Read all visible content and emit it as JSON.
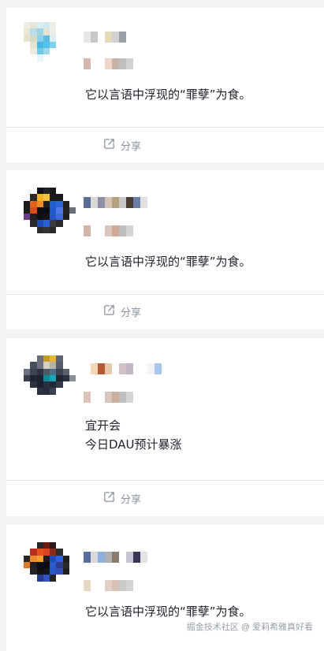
{
  "feed": {
    "posts": [
      {
        "author_name": "",
        "text": "它以言语中浮现的“罪孽”为食。",
        "share_label": "分享",
        "avatar_colors": [
          "#eeeee6",
          "#e6e6d8",
          "#d8eef4",
          "#cde9ef",
          "#ecece5",
          "#ffffff",
          "#ffffff",
          "#ffffff",
          "#e9e6d5",
          "#b8dde6",
          "#9fd3e3",
          "#e6e3d2",
          "#eeeee7",
          "#ffffff",
          "#ffffff",
          "#ffffff",
          "#e8e2ca",
          "#d7d8c6",
          "#8dd0e9",
          "#5bbde3",
          "#dbeef4",
          "#ffffff",
          "#ffffff",
          "#ffffff",
          "#ffffff",
          "#e6e3d0",
          "#48b7e6",
          "#53c3ea",
          "#7fd2ee",
          "#ffffff",
          "#ffffff",
          "#ffffff",
          "#ffffff",
          "#eeeae0",
          "#6fc9ea",
          "#9ed8ee",
          "#ffffff",
          "#ffffff",
          "#ffffff",
          "#ffffff",
          "#ffffff",
          "#ffffff",
          "#eaf6fb",
          "#ffffff",
          "#ffffff",
          "#ffffff",
          "#ffffff",
          "#ffffff",
          "#ffffff",
          "#ffffff",
          "#ffffff",
          "#ffffff",
          "#ffffff",
          "#ffffff",
          "#ffffff",
          "#ffffff",
          "#ffffff",
          "#ffffff",
          "#ffffff",
          "#ffffff",
          "#ffffff",
          "#ffffff",
          "#ffffff",
          "#ffffff"
        ],
        "name_colors": [
          "#e7e7e7",
          "#c5c9cc",
          "#ffffff",
          "#e4dbb8",
          "#d2d2d2",
          "#9aa1a6"
        ],
        "meta_colors": [
          "#d4b7ad",
          "#ffffff",
          "#ffffff",
          "#f0d6c8",
          "#c7b4a9",
          "#bfbfbf",
          "#d2d2d2"
        ]
      },
      {
        "author_name": "",
        "text": "它以言语中浮现的“罪孽”为食。",
        "share_label": "分享",
        "avatar_colors": [
          "#ffffff",
          "#ffffff",
          "#111111",
          "#222222",
          "#1b1b1b",
          "#ffffff",
          "#ffffff",
          "#ffffff",
          "#ffffff",
          "#2a2a2a",
          "#f2b329",
          "#f6c23a",
          "#1c1c1c",
          "#1a1a1a",
          "#ffffff",
          "#ffffff",
          "#1a1a1a",
          "#e4621f",
          "#f08d26",
          "#1d1d1d",
          "#1d5fcf",
          "#2a66d6",
          "#212121",
          "#ffffff",
          "#1c1c1c",
          "#e04a1a",
          "#0f0f0f",
          "#0c0c0c",
          "#2157cf",
          "#4e79e6",
          "#232323",
          "#6a6f7a",
          "#6b3c8c",
          "#1e1e1e",
          "#111111",
          "#141414",
          "#2456c9",
          "#3f6ad8",
          "#1f1f1f",
          "#ffffff",
          "#ffffff",
          "#2a2a2a",
          "#1f4bb8",
          "#2b5ed4",
          "#3a3a3a",
          "#2a2a2a",
          "#ffffff",
          "#ffffff",
          "#ffffff",
          "#ffffff",
          "#2d2d2d",
          "#343434",
          "#2b2b2b",
          "#ffffff",
          "#ffffff",
          "#ffffff",
          "#ffffff",
          "#ffffff",
          "#ffffff",
          "#ffffff",
          "#ffffff",
          "#ffffff",
          "#ffffff",
          "#ffffff"
        ],
        "name_colors": [
          "#5c6d96",
          "#d8d8d8",
          "#8f8fa8",
          "#d3c6b8",
          "#b5a27d",
          "#c6c6c6",
          "#4a3c33",
          "#6a7fa8",
          "#e1e1e1"
        ],
        "meta_colors": [
          "#d2b4aa",
          "#ffffff",
          "#ffffff",
          "#d6c6bd",
          "#cfa996",
          "#bdbdbd",
          "#d4d4d4"
        ]
      },
      {
        "author_name": "",
        "text": "宜开会\n今日DAU预计暴涨",
        "share_label": "分享",
        "avatar_colors": [
          "#ffffff",
          "#ffffff",
          "#6b6e78",
          "#c49a2b",
          "#e8b533",
          "#5d6470",
          "#ffffff",
          "#ffffff",
          "#ffffff",
          "#4a4f5e",
          "#6c7280",
          "#d6d0c2",
          "#b9b3a6",
          "#545b69",
          "#ffffff",
          "#ffffff",
          "#6d717b",
          "#3d4350",
          "#2d3340",
          "#515866",
          "#4b6e86",
          "#3a4352",
          "#5a606c",
          "#ffffff",
          "#3a3f4c",
          "#202734",
          "#1c2230",
          "#0f8a9a",
          "#16a6b4",
          "#1f2736",
          "#2a313f",
          "#8b8f96",
          "#ffffff",
          "#2c3340",
          "#1b2130",
          "#273040",
          "#212837",
          "#333b48",
          "#ffffff",
          "#ffffff",
          "#ffffff",
          "#ffffff",
          "#2b3242",
          "#262d3c",
          "#3a4150",
          "#ffffff",
          "#ffffff",
          "#ffffff",
          "#ffffff",
          "#ffffff",
          "#ffffff",
          "#ffffff",
          "#ffffff",
          "#ffffff",
          "#ffffff",
          "#ffffff",
          "#ffffff",
          "#ffffff",
          "#ffffff",
          "#ffffff",
          "#ffffff",
          "#ffffff",
          "#ffffff",
          "#ffffff"
        ],
        "name_colors": [
          "#ffffff",
          "#f4d5b8",
          "#b15a35",
          "#e8c6a8",
          "#ffffff",
          "#d3c0c4",
          "#c2b8c4",
          "#ffffff",
          "#ffffff",
          "#f2f4f7",
          "#a9c6ec"
        ],
        "meta_colors": [
          "#dbc3b8",
          "#ffffff",
          "#ffffff",
          "#d7c8be",
          "#cfae9c",
          "#c0c0c0",
          "#d4d4d4"
        ]
      },
      {
        "author_name": "",
        "text": "它以言语中浮现的“罪孽”为食。",
        "share_label": "分享",
        "avatar_colors": [
          "#ffffff",
          "#ffffff",
          "#272727",
          "#6e1a14",
          "#2a1a18",
          "#ffffff",
          "#ffffff",
          "#ffffff",
          "#ffffff",
          "#b82f1e",
          "#e4531f",
          "#d94420",
          "#8a2b1d",
          "#2c2c2c",
          "#ffffff",
          "#ffffff",
          "#262626",
          "#f08b2d",
          "#f4a030",
          "#1b1b1b",
          "#1d4cc1",
          "#2f62d8",
          "#202020",
          "#ffffff",
          "#e07a22",
          "#1f1f1f",
          "#0d0d0d",
          "#0b0b0b",
          "#2a5cd2",
          "#2d3c8a",
          "#292929",
          "#ffffff",
          "#ffffff",
          "#232323",
          "#121212",
          "#151515",
          "#2a55c4",
          "#334fb8",
          "#1f1f1f",
          "#ffffff",
          "#ffffff",
          "#ffffff",
          "#2a3b8c",
          "#2f55c8",
          "#252525",
          "#ffffff",
          "#ffffff",
          "#ffffff",
          "#ffffff",
          "#ffffff",
          "#ffffff",
          "#ffffff",
          "#ffffff",
          "#ffffff",
          "#ffffff",
          "#ffffff",
          "#ffffff",
          "#ffffff",
          "#ffffff",
          "#ffffff",
          "#ffffff",
          "#ffffff",
          "#ffffff",
          "#ffffff"
        ],
        "name_colors": [
          "#5a6d9c",
          "#dad8d8",
          "#8fb0df",
          "#b0b0b0",
          "#8b7d6e",
          "#ffffff",
          "#c8c4d3",
          "#3a3355",
          "#e4e4e4"
        ],
        "meta_colors": [
          "#e7d6c4",
          "#ffffff",
          "#ffffff",
          "#e0cfc6",
          "#d7c0b4",
          "#cacaca",
          "#d4d4d4"
        ]
      }
    ]
  },
  "watermark": "掘金技术社区 @ 爱莉希雅真好看"
}
